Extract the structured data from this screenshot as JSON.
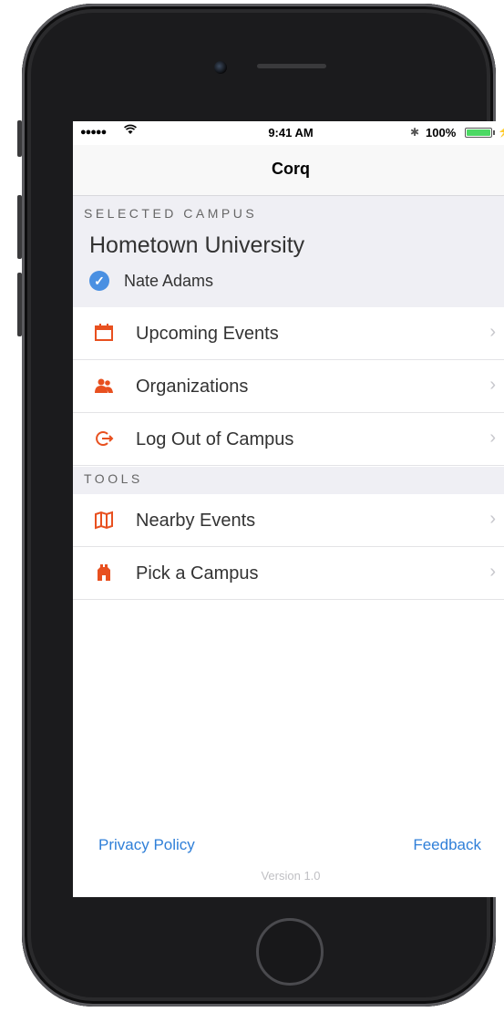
{
  "status_bar": {
    "signal": "●●●●●",
    "time": "9:41 AM",
    "battery_percent": "100%",
    "battery_level": 1.0
  },
  "nav": {
    "title": "Corq"
  },
  "campus": {
    "section_label": "SELECTED CAMPUS",
    "name": "Hometown University",
    "user": "Nate Adams"
  },
  "menu": [
    {
      "label": "Upcoming Events",
      "icon": "calendar-icon"
    },
    {
      "label": "Organizations",
      "icon": "people-icon"
    },
    {
      "label": "Log Out of Campus",
      "icon": "logout-icon"
    }
  ],
  "tools": {
    "section_label": "TOOLS",
    "items": [
      {
        "label": "Nearby Events",
        "icon": "map-icon"
      },
      {
        "label": "Pick a Campus",
        "icon": "building-icon"
      }
    ]
  },
  "footer": {
    "privacy": "Privacy Policy",
    "feedback": "Feedback",
    "version": "Version 1.0"
  },
  "colors": {
    "accent_icon": "#e8501f",
    "link": "#2f7fd8",
    "check": "#4a90e2",
    "battery": "#4cd964"
  }
}
